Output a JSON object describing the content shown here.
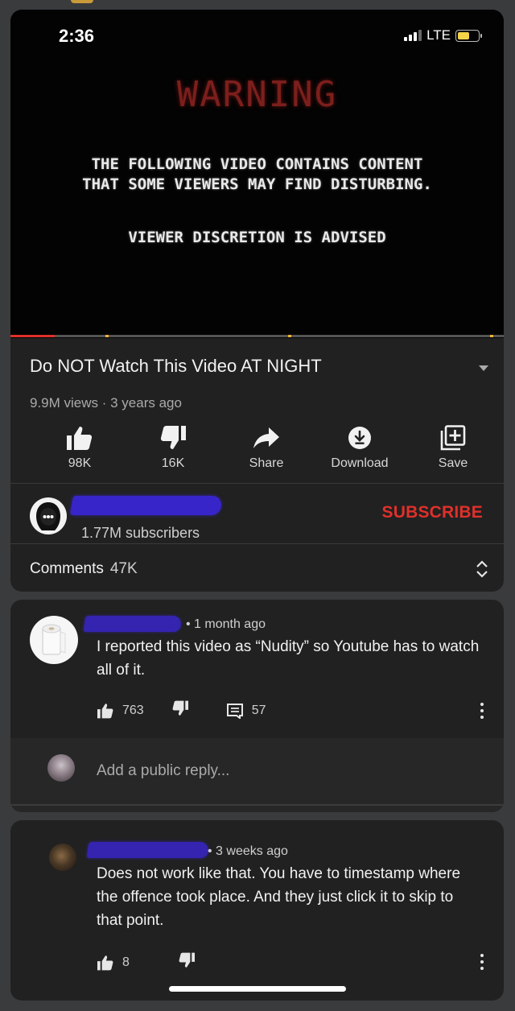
{
  "status_bar": {
    "time": "2:36",
    "network": "LTE",
    "battery_level": 0.6
  },
  "video": {
    "warning_title": "WARNING",
    "warning_line1": "THE FOLLOWING VIDEO CONTAINS CONTENT",
    "warning_line2": "THAT SOME VIEWERS MAY FIND DISTURBING.",
    "discretion": "VIEWER DISCRETION IS ADVISED",
    "played_fraction": 0.09,
    "title": "Do NOT Watch This Video AT NIGHT",
    "meta": "9.9M views · 3 years ago"
  },
  "actions": [
    {
      "icon": "thumbs-up-icon",
      "label": "98K"
    },
    {
      "icon": "thumbs-down-icon",
      "label": "16K"
    },
    {
      "icon": "share-icon",
      "label": "Share"
    },
    {
      "icon": "download-icon",
      "label": "Download"
    },
    {
      "icon": "save-playlist-icon",
      "label": "Save"
    }
  ],
  "channel": {
    "subscribers": "1.77M subscribers",
    "subscribe_label": "SUBSCRIBE"
  },
  "comments_header": {
    "label": "Comments",
    "count": "47K"
  },
  "comment1": {
    "time": "• 1 month ago",
    "text": "I reported this video as “Nudity” so Youtube has to watch all of it.",
    "likes": "763",
    "replies": "57",
    "reply_placeholder": "Add a public reply..."
  },
  "comment2": {
    "time": "• 3 weeks ago",
    "text": "Does not work like that. You have to timestamp where the offence took place. And they just click it to skip to that point.",
    "likes": "8"
  },
  "colors": {
    "accent": "#e0302a",
    "background": "#212121",
    "redaction": "#3825c9"
  }
}
